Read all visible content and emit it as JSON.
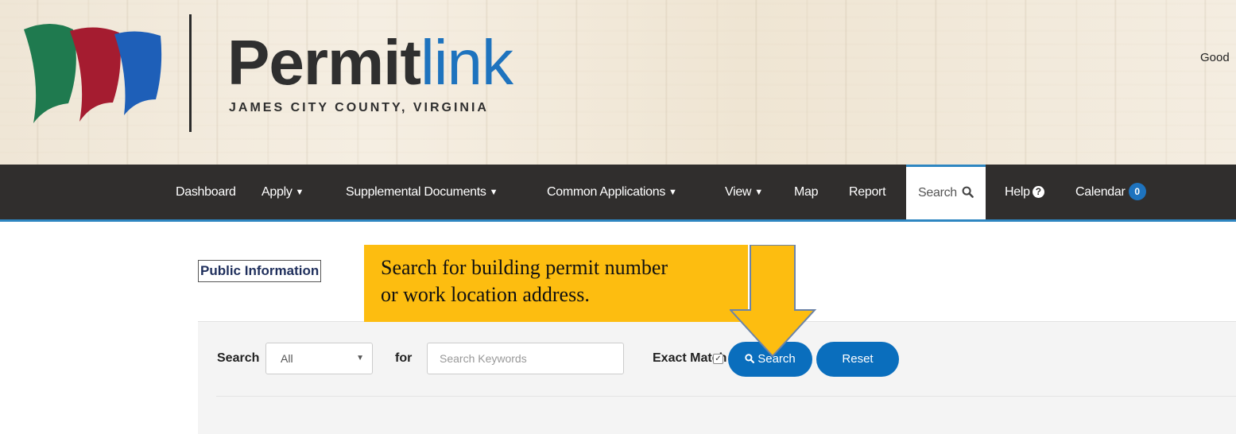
{
  "header": {
    "logo_bold": "Permit",
    "logo_light": "link",
    "logo_subtitle": "JAMES CITY COUNTY, VIRGINIA",
    "greeting": "Good",
    "flag_colors": [
      "#1f7a4f",
      "#a51c30",
      "#1e5fb8"
    ]
  },
  "nav": {
    "items": [
      {
        "label": "Dashboard",
        "dropdown": false
      },
      {
        "label": "Apply",
        "dropdown": true
      },
      {
        "label": "Supplemental Documents",
        "dropdown": true
      },
      {
        "label": "Common Applications",
        "dropdown": true
      },
      {
        "label": "View",
        "dropdown": true
      },
      {
        "label": "Map",
        "dropdown": false
      },
      {
        "label": "Report",
        "dropdown": false
      },
      {
        "label": "Search",
        "active": true,
        "icon": "search-icon"
      },
      {
        "label": "Help",
        "icon": "question-circle-icon"
      },
      {
        "label": "Calendar",
        "badge": "0"
      }
    ],
    "background": "#302e2d",
    "accent": "#2e86c1"
  },
  "content": {
    "section_title": "Public Information",
    "search": {
      "label": "Search",
      "scope_selected": "All",
      "for_label": "for",
      "keywords_placeholder": "Search Keywords",
      "exact_match_label": "Exact Match",
      "exact_match_checked": true,
      "search_button": "Search",
      "reset_button": "Reset",
      "button_color": "#0a6ebd"
    }
  },
  "callout": {
    "line1": "Search for building permit number",
    "line2": "or work location address.",
    "color": "#fdbd10"
  }
}
